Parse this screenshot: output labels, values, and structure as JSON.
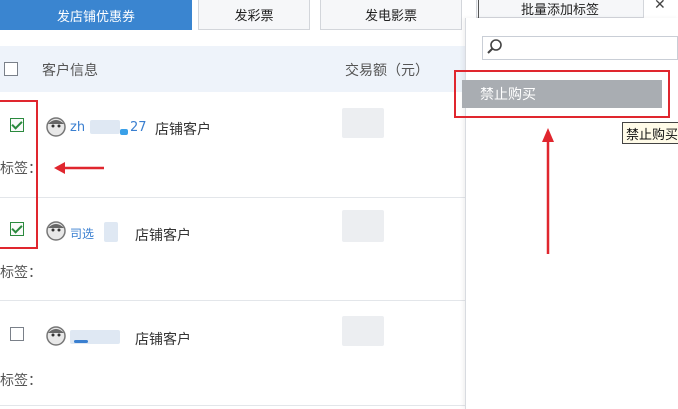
{
  "toolbar": {
    "coupon_btn": "发店铺优惠券",
    "lottery_btn": "发彩票",
    "movie_btn": "发电影票",
    "bulk_tag_btn": "批量添加标签"
  },
  "table": {
    "col_customer": "客户信息",
    "col_amount": "交易额（元）",
    "rows": [
      {
        "name": "zh",
        "name_suffix": "27",
        "type": "店铺客户",
        "tag_label": "标签：",
        "checked": true
      },
      {
        "name": "司选",
        "type": "店铺客户",
        "tag_label": "标签：",
        "checked": true
      },
      {
        "name": "",
        "type": "店铺客户",
        "tag_label": "标签：",
        "checked": false
      }
    ]
  },
  "dropdown": {
    "search_placeholder": "",
    "item_label": "禁止购买",
    "tooltip": "禁止购买"
  },
  "colors": {
    "accent": "#3a85d0",
    "annotation_red": "#e0262e",
    "menu_selected": "#a9adb2"
  }
}
